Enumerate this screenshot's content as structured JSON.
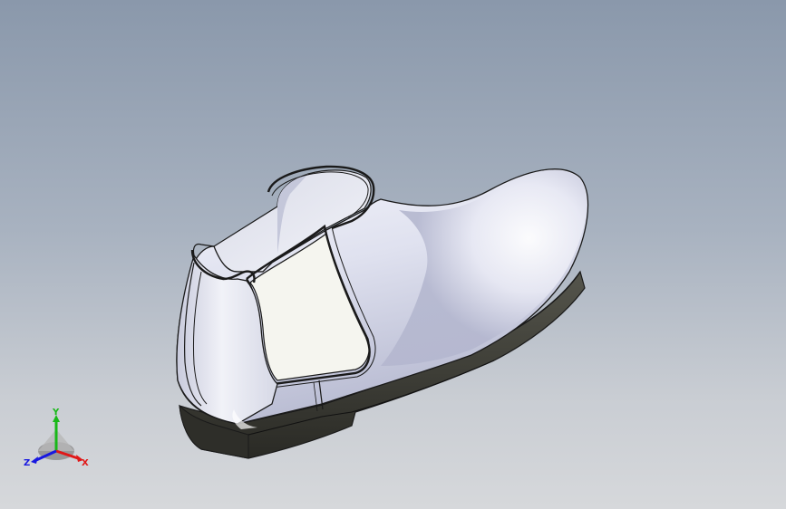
{
  "viewport": {
    "background_top": "#8a98ab",
    "background_bottom": "#d6d8db"
  },
  "model": {
    "upper_color": "#e4e6f2",
    "upper_shadow": "#a8acc4",
    "elastic_panel_color": "#f4f4ee",
    "sole_color": "#3a3a34",
    "outline_color": "#1a1a1a"
  },
  "triad": {
    "x_label": "X",
    "y_label": "Y",
    "z_label": "Z",
    "x_color": "#e01818",
    "y_color": "#18b818",
    "z_color": "#1818e0"
  }
}
